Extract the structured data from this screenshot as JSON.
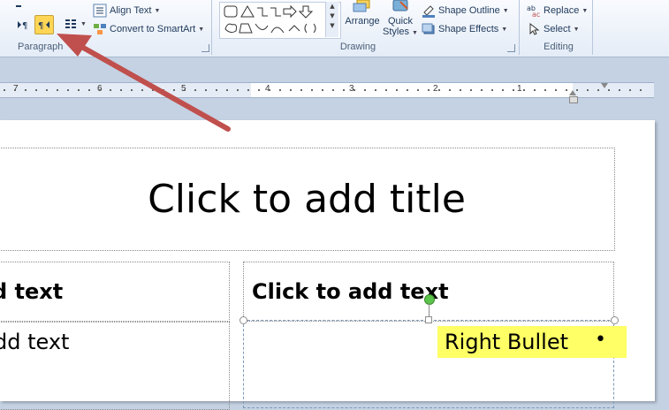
{
  "ribbon": {
    "paragraph": {
      "label": "Paragraph",
      "align_text": "Align Text",
      "convert_smartart": "Convert to SmartArt"
    },
    "drawing": {
      "label": "Drawing",
      "arrange": "Arrange",
      "quick_styles_1": "Quick",
      "quick_styles_2": "Styles",
      "shape_outline": "Shape Outline",
      "shape_effects": "Shape Effects"
    },
    "editing": {
      "label": "Editing",
      "replace": "Replace",
      "select": "Select"
    }
  },
  "ruler": {
    "labels_left": [
      "7",
      "6",
      "5",
      "4",
      "3",
      "2",
      "1"
    ]
  },
  "slide": {
    "title_placeholder": "Click to add title",
    "left_heading": "d text",
    "left_body": "dd text",
    "right_heading": "Click to add text",
    "right_bullet": "Right Bullet",
    "bullet_char": "•"
  },
  "colors": {
    "highlight": "#ffff66",
    "annotation_arrow": "#c0504d",
    "rtl_button_bg": "#ffd555"
  }
}
